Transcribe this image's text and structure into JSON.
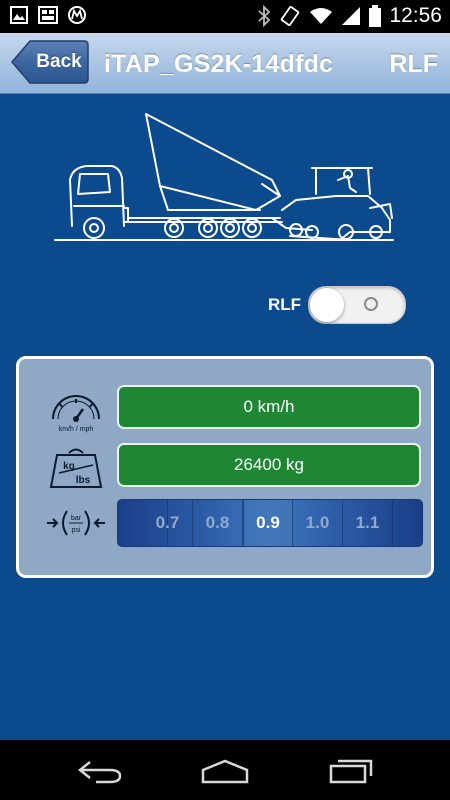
{
  "status_bar": {
    "time": "12:56",
    "left_icons": [
      "image-icon",
      "gallery-icon",
      "motorola-icon"
    ],
    "right_icons": [
      "bluetooth-icon",
      "rotation-icon",
      "wifi-icon",
      "signal-icon",
      "battery-icon"
    ]
  },
  "header": {
    "back_label": "Back",
    "title": "iTAP_GS2K-14dfdc",
    "right_label": "RLF"
  },
  "rlf_toggle": {
    "label": "RLF",
    "state": "off"
  },
  "panel": {
    "speed": {
      "icon": "speedometer-icon",
      "icon_caption": "km/h / mph",
      "value": "0 km/h"
    },
    "weight": {
      "icon": "weight-icon",
      "icon_top": "kg",
      "icon_bottom": "lbs",
      "value": "26400 kg"
    },
    "pressure": {
      "icon": "pressure-icon",
      "icon_top": "bar",
      "icon_bottom": "psi",
      "options": [
        "0.7",
        "0.8",
        "0.9",
        "1.0",
        "1.1"
      ],
      "selected": "0.9"
    }
  },
  "colors": {
    "background": "#0b4a8c",
    "value_green": "#1f8734",
    "panel": "#8ea8c6"
  },
  "nav_bar": {
    "icons": [
      "back-nav-icon",
      "home-nav-icon",
      "recents-nav-icon"
    ]
  }
}
